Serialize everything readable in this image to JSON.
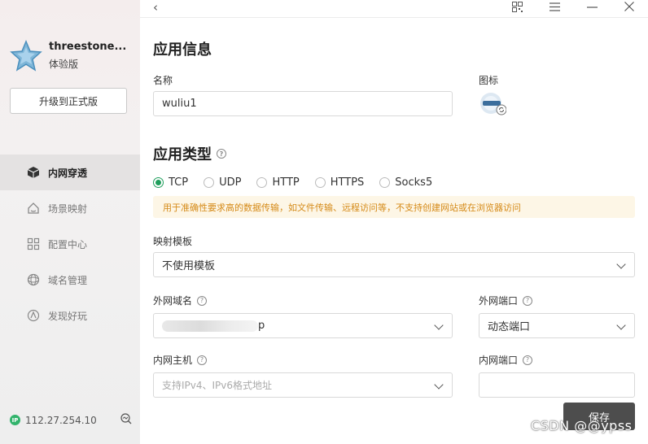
{
  "sidebar": {
    "username": "threestone...",
    "edition": "体验版",
    "upgrade_label": "升级到正式版",
    "items": [
      {
        "label": "内网穿透",
        "icon": "cube-icon",
        "active": true
      },
      {
        "label": "场景映射",
        "icon": "home-icon",
        "active": false
      },
      {
        "label": "配置中心",
        "icon": "grid-icon",
        "active": false
      },
      {
        "label": "域名管理",
        "icon": "globe-icon",
        "active": false
      },
      {
        "label": "发现好玩",
        "icon": "compass-icon",
        "active": false
      }
    ],
    "ip_badge": "IP",
    "ip_address": "112.27.254.10"
  },
  "topbar": {
    "back_icon": "chevron-left-icon",
    "icons": [
      "qrcode-icon",
      "menu-icon",
      "minimize-icon",
      "close-icon"
    ]
  },
  "app_info": {
    "title": "应用信息",
    "name_label": "名称",
    "name_value": "wuliu1",
    "icon_label": "图标"
  },
  "app_type": {
    "title": "应用类型",
    "options": [
      "TCP",
      "UDP",
      "HTTP",
      "HTTPS",
      "Socks5"
    ],
    "selected": "TCP",
    "notice": "用于准确性要求高的数据传输，如文件传输、远程访问等，不支持创建网站或在浏览器访问"
  },
  "template": {
    "label": "映射模板",
    "value": "不使用模板"
  },
  "external_domain": {
    "label": "外网域名",
    "value_suffix": "p"
  },
  "external_port": {
    "label": "外网端口",
    "value": "动态端口"
  },
  "internal_host": {
    "label": "内网主机",
    "placeholder": "支持IPv4、IPv6格式地址"
  },
  "internal_port": {
    "label": "内网端口",
    "value": ""
  },
  "save_label": "保存",
  "watermark": "CSDN @@ypss",
  "colors": {
    "accent": "#1f9e5c",
    "notice_text": "#d58a18",
    "notice_bg": "#fdf6e6",
    "save_bg": "#4d4d4d",
    "ip_badge": "#31b36b"
  }
}
